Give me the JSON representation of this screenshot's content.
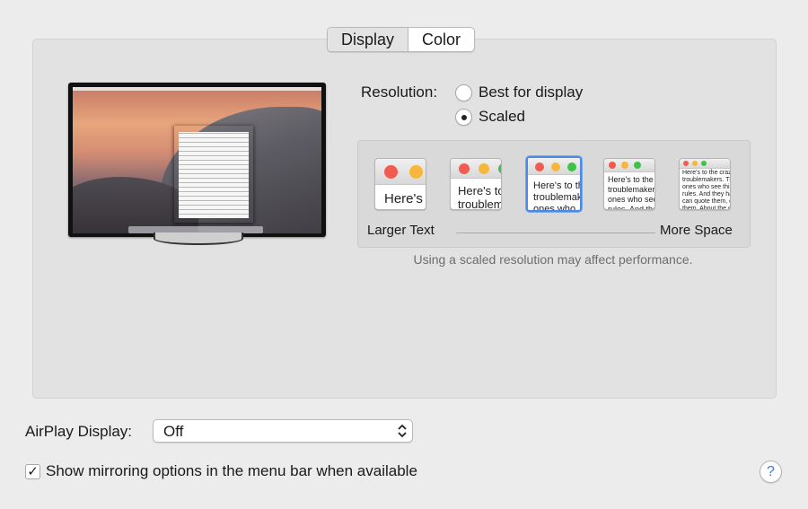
{
  "tabs": [
    {
      "label": "Display",
      "selected": true
    },
    {
      "label": "Color",
      "selected": false
    }
  ],
  "resolution": {
    "label": "Resolution:",
    "options": [
      {
        "label": "Best for display",
        "selected": false
      },
      {
        "label": "Scaled",
        "selected": true
      }
    ]
  },
  "scaling": {
    "options": [
      {
        "text": "Here's",
        "selected": false
      },
      {
        "text": "Here's to\ntroublem",
        "selected": false
      },
      {
        "text": "Here's to th\ntroublemak\nones who",
        "selected": true
      },
      {
        "text": "Here's to the cr\ntroublemakers\nones who see t\nrules. And they",
        "selected": false
      },
      {
        "text": "Here's to the crazy one\ntroublemakers. The rou\nones who see things di\nrules. And they have no\ncan quote them, disagr\nthem. About the only th\nBecause they change th",
        "selected": false
      }
    ],
    "left_label": "Larger Text",
    "right_label": "More Space",
    "note": "Using a scaled resolution may affect performance."
  },
  "airplay": {
    "label": "AirPlay Display:",
    "value": "Off"
  },
  "mirroring": {
    "label": "Show mirroring options in the menu bar when available",
    "checked": true,
    "check_glyph": "✓"
  },
  "help": {
    "glyph": "?"
  },
  "colors": {
    "window_bg": "#ececec",
    "accent": "#4a8ae6",
    "close": "#f15b50",
    "minimize": "#f6b73c",
    "zoom": "#3ec24a"
  },
  "icons": [
    "help-icon",
    "chevron-updown-icon",
    "checkmark-icon"
  ]
}
